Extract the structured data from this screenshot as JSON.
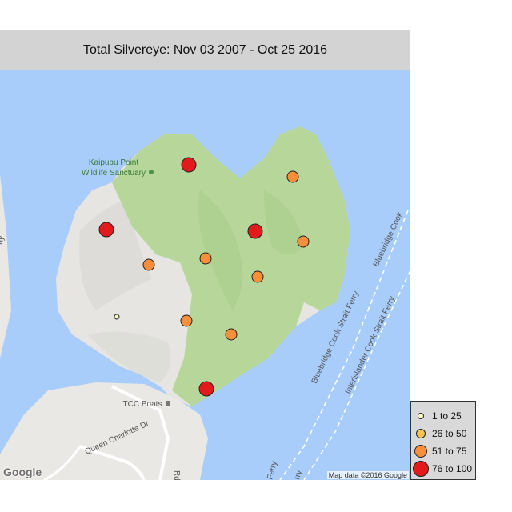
{
  "title": "Total Silvereye: Nov 03 2007 - Oct 25 2016",
  "map": {
    "places": {
      "sanctuary_line1": "Kaipupu Point",
      "sanctuary_line2": "Wildlife Sanctuary",
      "boats": "TCC Boats",
      "road": "Queen Charlotte Dr",
      "road_partial": "Rd",
      "ferry1": "Bluebridge Cook Strait Ferry",
      "ferry1b": "Bluebridge Cook",
      "ferry2": "Interislander Cook Strait Ferry",
      "ferry_partial_a": "Ferry",
      "ferry_partial_b": "rry",
      "edge_partial": "ay"
    },
    "google_logo": "Google",
    "attribution": "Map data ©2016 Google",
    "colors": {
      "water": "#a8cdfb",
      "land": "#e6e5e1",
      "park": "#b6d69a",
      "road": "#ffffff"
    }
  },
  "legend": {
    "items": [
      {
        "label": "1 to 25",
        "color": "#ffffcc",
        "size": 6
      },
      {
        "label": "26 to 50",
        "color": "#fec44f",
        "size": 10
      },
      {
        "label": "51 to 75",
        "color": "#f98f3a",
        "size": 14
      },
      {
        "label": "76 to 100",
        "color": "#e31a1c",
        "size": 18
      }
    ]
  },
  "observations": [
    {
      "category": 3,
      "label": "76 to 100"
    },
    {
      "category": 2,
      "label": "51 to 75"
    },
    {
      "category": 3,
      "label": "76 to 100"
    },
    {
      "category": 3,
      "label": "76 to 100"
    },
    {
      "category": 2,
      "label": "51 to 75"
    },
    {
      "category": 2,
      "label": "51 to 75"
    },
    {
      "category": 2,
      "label": "51 to 75"
    },
    {
      "category": 2,
      "label": "51 to 75"
    },
    {
      "category": 0,
      "label": "1 to 25"
    },
    {
      "category": 2,
      "label": "51 to 75"
    },
    {
      "category": 2,
      "label": "51 to 75"
    },
    {
      "category": 3,
      "label": "76 to 100"
    }
  ]
}
